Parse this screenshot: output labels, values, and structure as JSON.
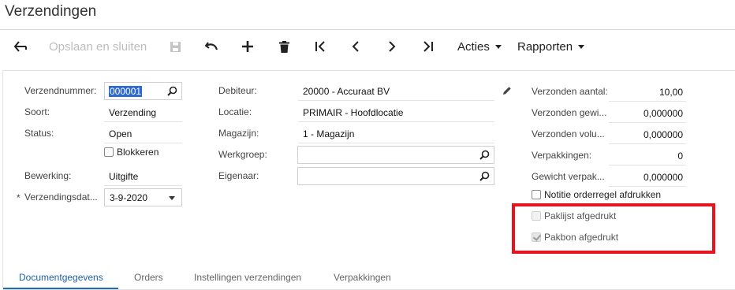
{
  "page": {
    "title": "Verzendingen"
  },
  "toolbar": {
    "save_close_label": "Opslaan en sluiten",
    "actions_label": "Acties",
    "reports_label": "Rapporten"
  },
  "form": {
    "shipment_number": {
      "label": "Verzendnummer:",
      "value": "000001"
    },
    "type": {
      "label": "Soort:",
      "value": "Verzending"
    },
    "status": {
      "label": "Status:",
      "value": "Open"
    },
    "hold": {
      "label": "Blokkeren",
      "checked": false
    },
    "operation": {
      "label": "Bewerking:",
      "value": "Uitgifte"
    },
    "shipment_date": {
      "label": "Verzendingsdat...",
      "required_mark": "*",
      "value": "3-9-2020"
    },
    "customer": {
      "label": "Debiteur:",
      "value": "20000 - Accuraat BV"
    },
    "location": {
      "label": "Locatie:",
      "value": "PRIMAIR - Hoofdlocatie"
    },
    "warehouse": {
      "label": "Magazijn:",
      "value": "1 - Magazijn"
    },
    "workgroup": {
      "label": "Werkgroep:",
      "value": ""
    },
    "owner": {
      "label": "Eigenaar:",
      "value": ""
    },
    "shipped_qty": {
      "label": "Verzonden aantal:",
      "value": "10,00"
    },
    "shipped_weight": {
      "label": "Verzonden gewi...",
      "value": "0,000000"
    },
    "shipped_volume": {
      "label": "Verzonden volu...",
      "value": "0,000000"
    },
    "packages": {
      "label": "Verpakkingen:",
      "value": "0"
    },
    "package_weight": {
      "label": "Gewicht verpak...",
      "value": "0,000000"
    },
    "print_line_notes": {
      "label": "Notitie orderregel afdrukken",
      "checked": false
    },
    "packing_list_printed": {
      "label": "Paklijst afgedrukt",
      "checked": false
    },
    "confirmation_printed": {
      "label": "Pakbon afgedrukt",
      "checked": true
    }
  },
  "tabs": [
    {
      "label": "Documentgegevens",
      "active": true
    },
    {
      "label": "Orders",
      "active": false
    },
    {
      "label": "Instellingen verzendingen",
      "active": false
    },
    {
      "label": "Verpakkingen",
      "active": false
    }
  ],
  "colors": {
    "accent": "#1f6bb5",
    "highlight": "#e8131c"
  },
  "icons": [
    "back-icon",
    "save-icon",
    "undo-icon",
    "add-icon",
    "delete-icon",
    "first-icon",
    "previous-icon",
    "next-icon",
    "last-icon",
    "search-icon",
    "edit-icon"
  ]
}
